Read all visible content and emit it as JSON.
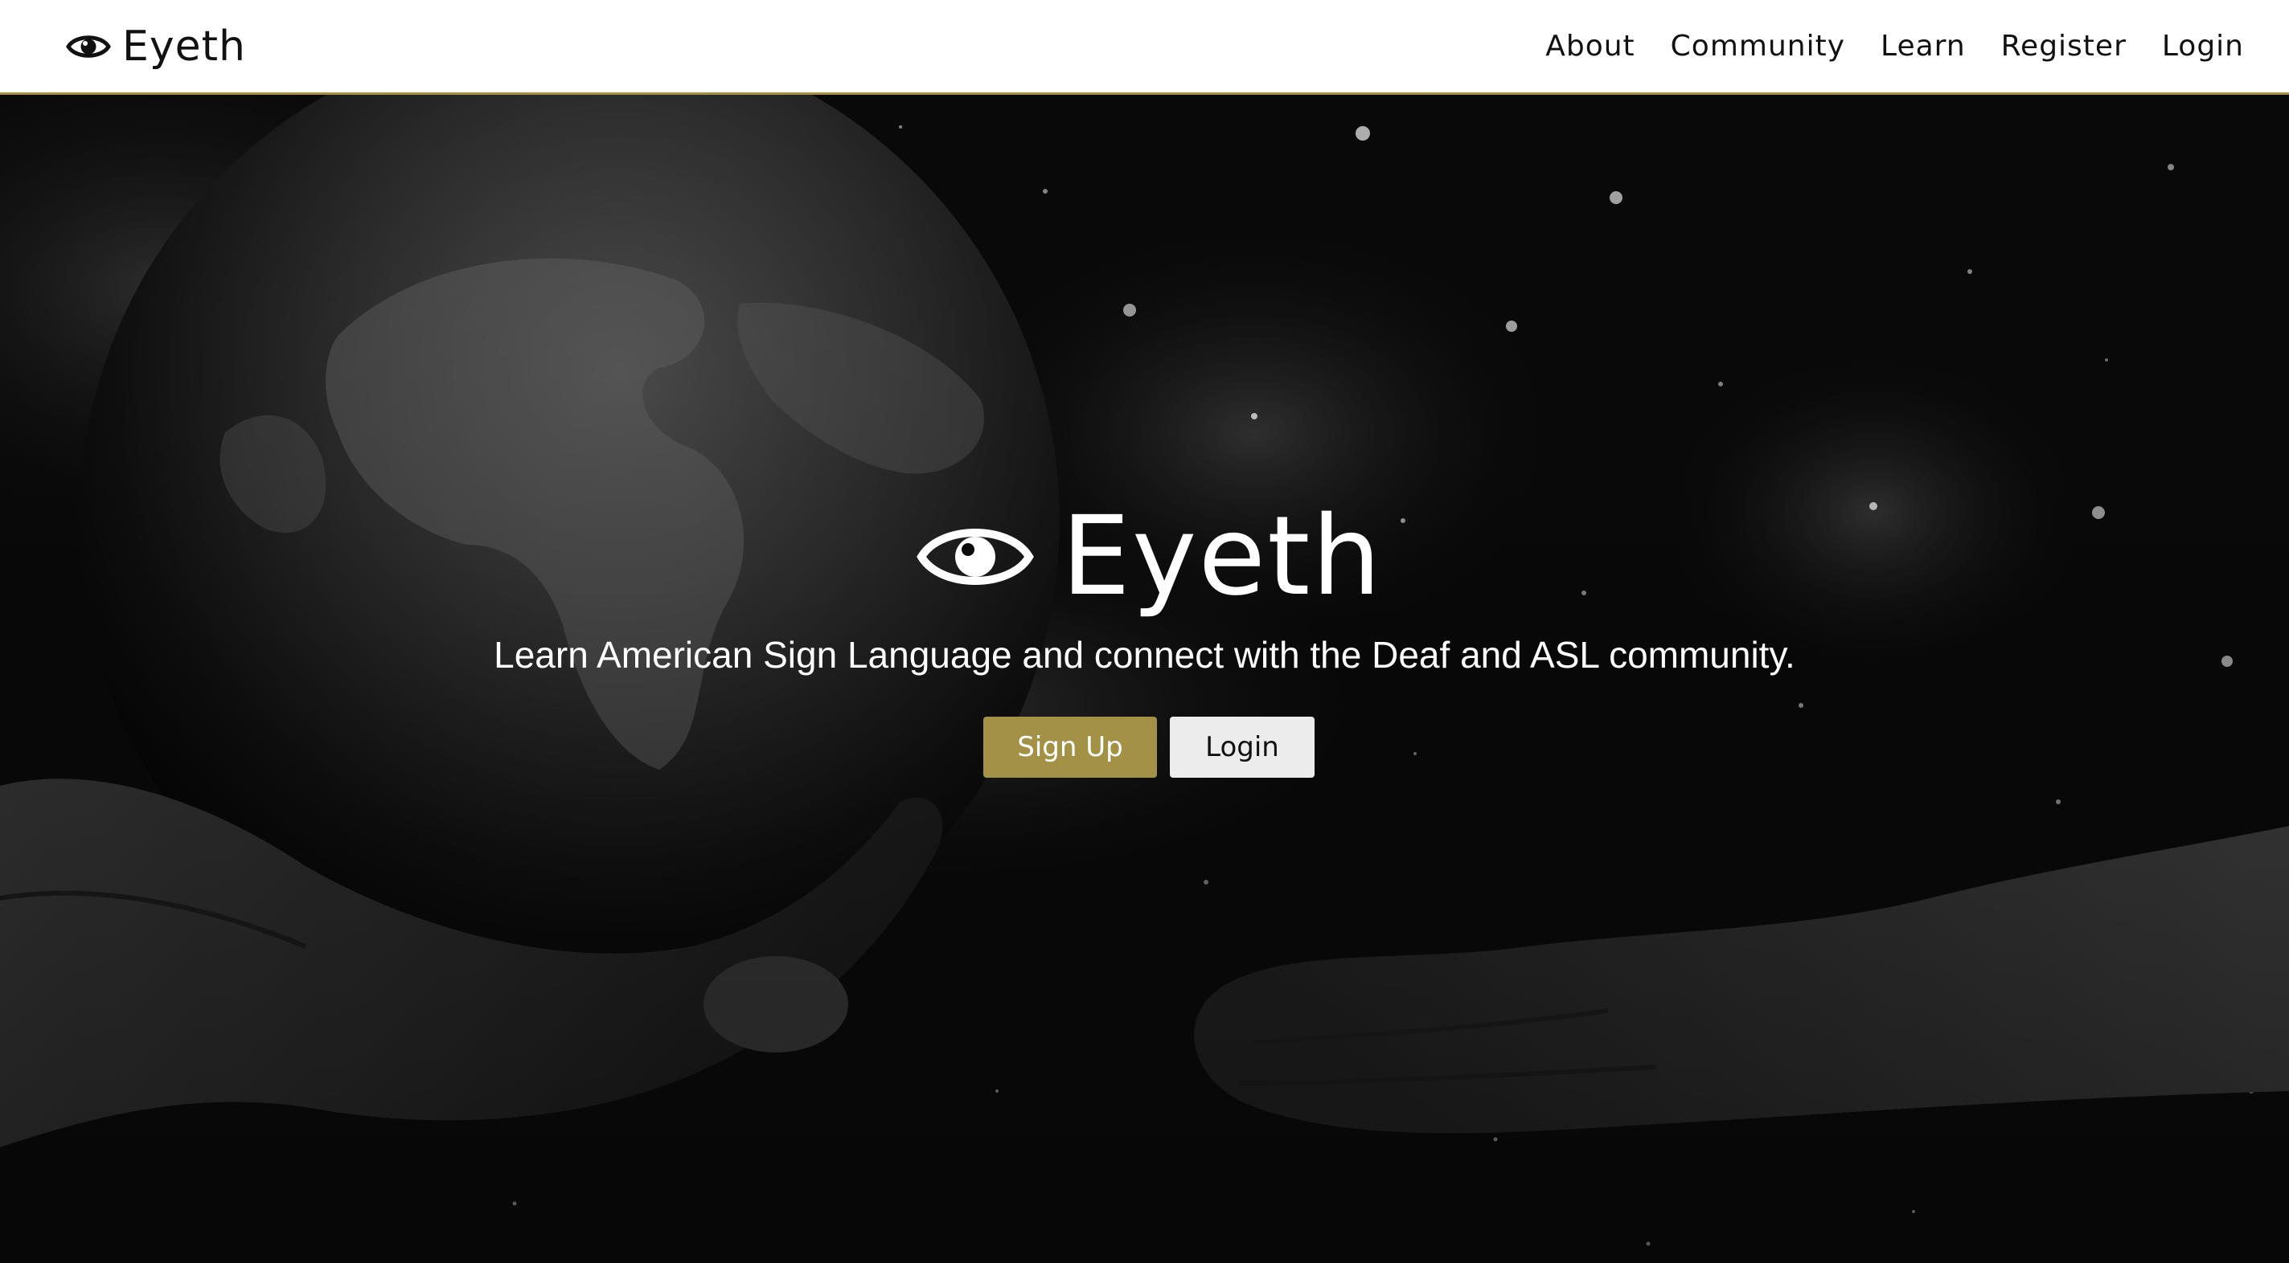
{
  "colors": {
    "accent": "#a39146",
    "nav_bg": "#ffffff",
    "hero_text": "#ffffff",
    "login_button_bg": "#ececec"
  },
  "navbar": {
    "brand": "Eyeth",
    "brand_icon": "eye-icon",
    "links": [
      {
        "label": "About"
      },
      {
        "label": "Community"
      },
      {
        "label": "Learn"
      },
      {
        "label": "Register"
      },
      {
        "label": "Login"
      }
    ]
  },
  "hero": {
    "brand": "Eyeth",
    "brand_icon": "eye-icon",
    "tagline": "Learn American Sign Language and connect with the Deaf and ASL community.",
    "signup_label": "Sign Up",
    "login_label": "Login"
  }
}
